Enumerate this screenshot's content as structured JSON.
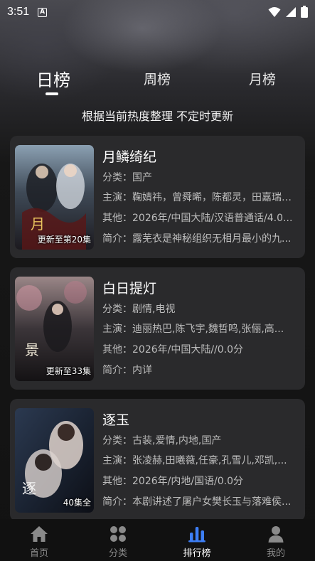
{
  "status": {
    "time": "3:51",
    "notif_icon": "A"
  },
  "tabs": [
    {
      "label": "日榜",
      "active": true
    },
    {
      "label": "周榜",
      "active": false
    },
    {
      "label": "月榜",
      "active": false
    }
  ],
  "subtitle": "根据当前热度整理 不定时更新",
  "items": [
    {
      "title": "月鳞绮纪",
      "badge": "更新至第20集",
      "category": "分类：国产",
      "cast": "主演：鞠婧祎，曾舜晞，陈都灵，田嘉瑞，...",
      "other": "其他：2026年/中国大陆/汉语普通话/4.0...",
      "intro": "简介：露芜衣是神秘组织无相月最小的九..."
    },
    {
      "title": "白日提灯",
      "badge": "更新至33集",
      "category": "分类：剧情,电视",
      "cast": "主演：迪丽热巴,陈飞宇,魏哲鸣,张俪,高...",
      "other": "其他：2026年/中国大陆//0.0分",
      "intro": "简介：内详"
    },
    {
      "title": "逐玉",
      "badge": "40集全",
      "category": "分类：古装,爱情,内地,国产",
      "cast": "主演：张凌赫,田曦薇,任豪,孔雪儿,邓凯,...",
      "other": "其他：2026年/内地/国语/0.0分",
      "intro": "简介：本剧讲述了屠户女樊长玉与落难侯..."
    }
  ],
  "nav": [
    {
      "label": "首页",
      "icon": "home-icon",
      "active": false
    },
    {
      "label": "分类",
      "icon": "category-grid-icon",
      "active": false
    },
    {
      "label": "排行榜",
      "icon": "ranking-bars-icon",
      "active": true
    },
    {
      "label": "我的",
      "icon": "profile-icon",
      "active": false
    }
  ],
  "colors": {
    "active_accent": "#3d7ef5",
    "nav_inactive": "#8a8a8a",
    "card_bg": "#2a2a2c"
  }
}
